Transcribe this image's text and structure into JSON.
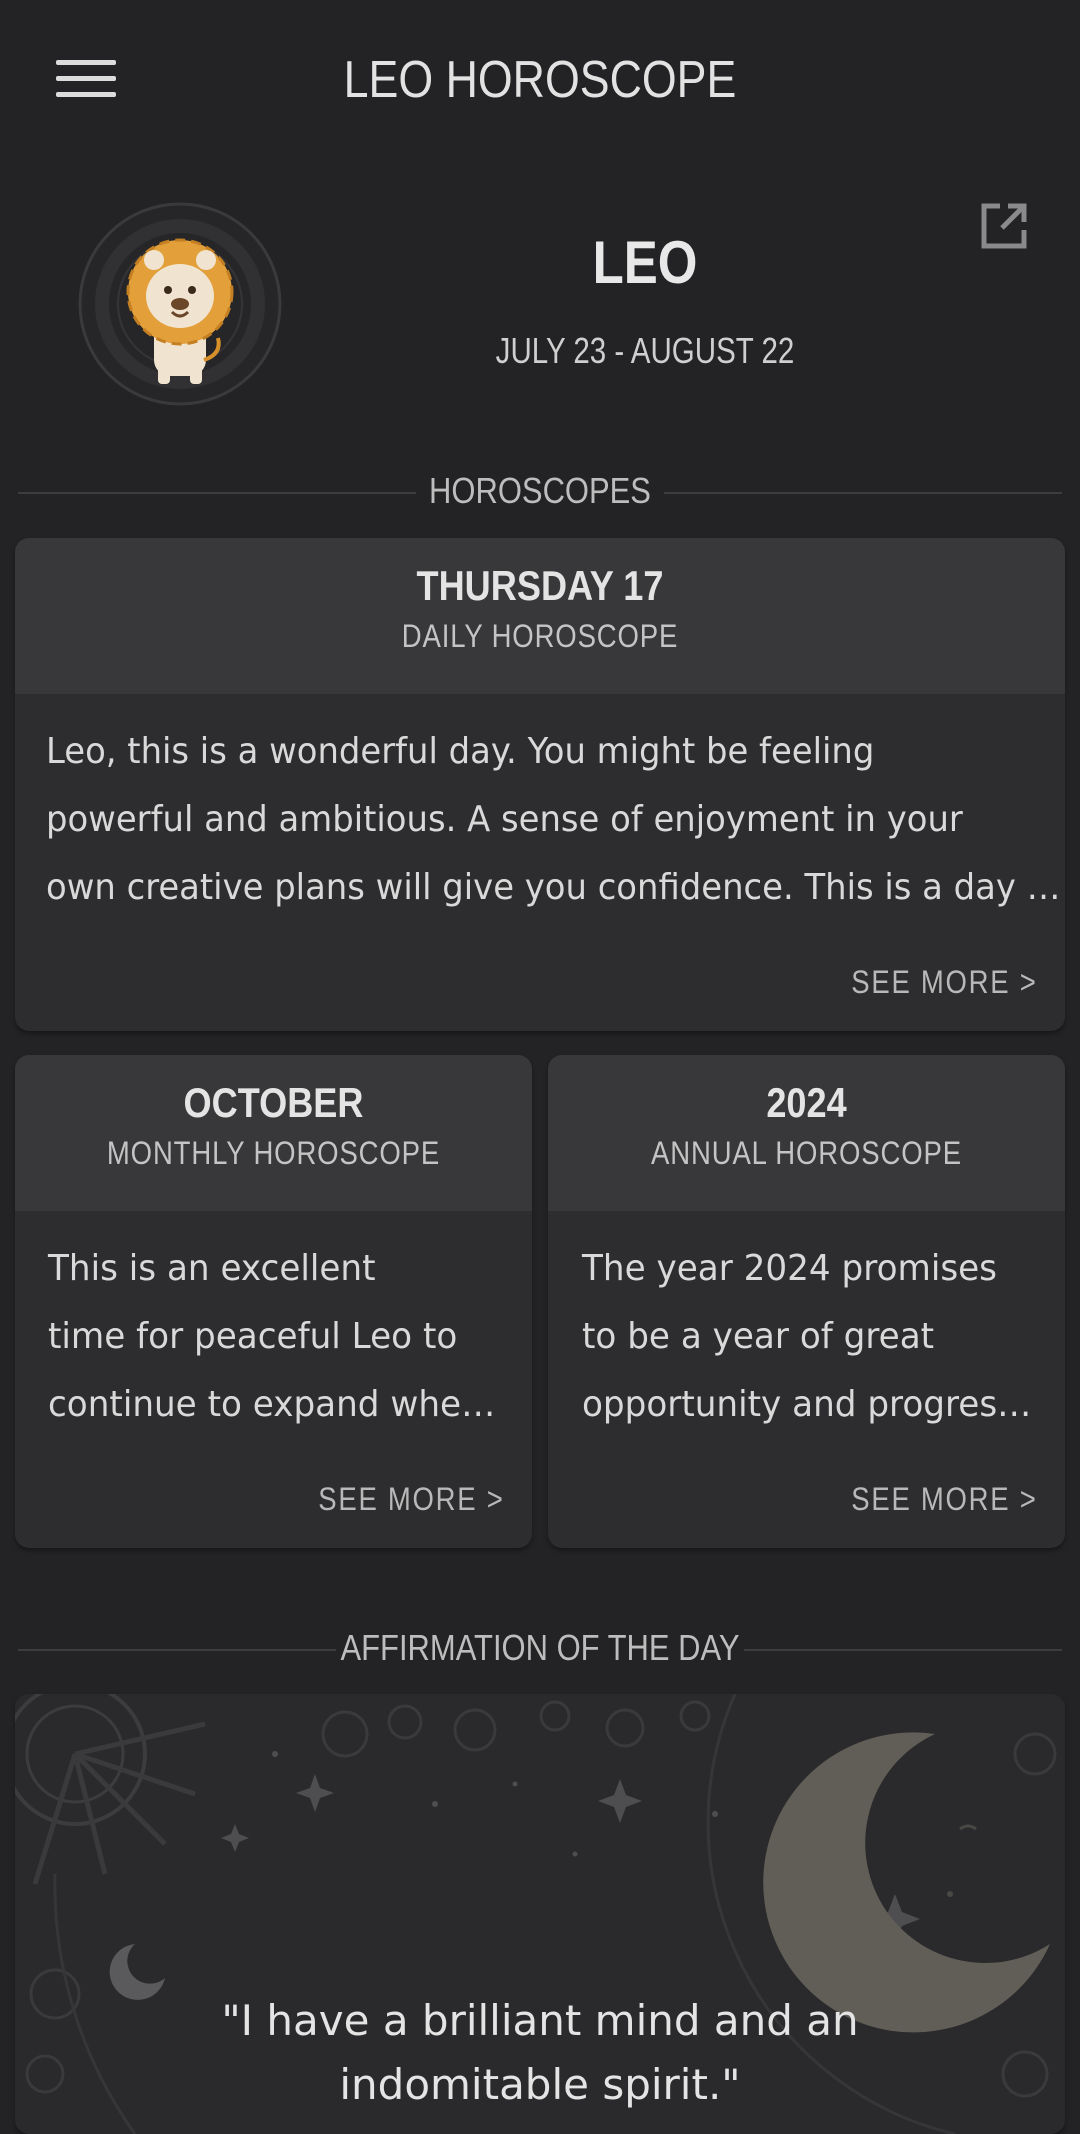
{
  "header": {
    "title": "LEO HOROSCOPE",
    "menu_icon": "hamburger-menu-icon"
  },
  "sign": {
    "name": "LEO",
    "dates": "JULY 23 - AUGUST 22",
    "share_icon": "external-link-icon"
  },
  "sections": {
    "horoscopes": "HOROSCOPES",
    "affirmation": "AFFIRMATION OF THE DAY"
  },
  "daily": {
    "title": "THURSDAY 17",
    "subtitle": "DAILY HOROSCOPE",
    "lines": [
      "Leo, this is a wonderful day. You might be feeling",
      "powerful and ambitious. A sense of enjoyment in your",
      "own creative plans will give you confidence. This is a day …"
    ],
    "see_more": "SEE MORE  >"
  },
  "monthly": {
    "title": "OCTOBER",
    "subtitle": "MONTHLY HOROSCOPE",
    "lines": [
      "This is an excellent",
      "time for peaceful Leo to",
      "continue to expand whe…"
    ],
    "see_more": "SEE MORE  >"
  },
  "annual": {
    "title": "2024",
    "subtitle": "ANNUAL HOROSCOPE",
    "lines": [
      "The year 2024 promises",
      "to be a year of great",
      "opportunity and progres…"
    ],
    "see_more": "SEE MORE  >"
  },
  "affirmation": {
    "lines": [
      "\"I have a brilliant mind and an",
      "indomitable spirit.\""
    ]
  },
  "colors": {
    "background": "#232325",
    "card": "#2d2d2f",
    "card_header": "#38383a",
    "lion": "#e3a03a"
  }
}
